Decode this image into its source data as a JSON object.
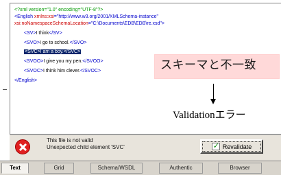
{
  "editor": {
    "lines": [
      {
        "parts": [
          {
            "cls": "pi",
            "text": "<?xml version=\"1.0\" encoding=\"UTF-8\"?>"
          }
        ]
      },
      {
        "parts": [
          {
            "cls": "tag",
            "text": "<English "
          },
          {
            "cls": "attr",
            "text": "xmlns:xsi"
          },
          {
            "cls": "tag",
            "text": "=\"http://www.w3.org/2001/XMLSchema-instance\""
          }
        ]
      },
      {
        "parts": [
          {
            "cls": "attr",
            "text": "xsi:noNamespaceSchemaLocation"
          },
          {
            "cls": "tag",
            "text": "=\"C:\\Documents\\EDB\\EDB\\re.xsd\">"
          }
        ]
      },
      {
        "parts": [
          {
            "cls": "tag",
            "text": "<SV>"
          },
          {
            "cls": "txt",
            "text": "I think"
          },
          {
            "cls": "tag",
            "text": "</SV>"
          }
        ]
      },
      {
        "parts": [
          {
            "cls": "tag",
            "text": "<SVO>"
          },
          {
            "cls": "txt",
            "text": "I go to school."
          },
          {
            "cls": "tag",
            "text": "</SVO>"
          }
        ]
      },
      {
        "parts": [
          {
            "cls": "tag",
            "text": "<SVC>"
          },
          {
            "cls": "txt",
            "text": "I am a boy."
          },
          {
            "cls": "tag",
            "text": "</SVC>"
          }
        ],
        "selected": true
      },
      {
        "parts": [
          {
            "cls": "tag",
            "text": "<SVOO>"
          },
          {
            "cls": "txt",
            "text": "I give you my pen."
          },
          {
            "cls": "tag",
            "text": "</SVOO>"
          }
        ]
      },
      {
        "parts": [
          {
            "cls": "tag",
            "text": "<SVOC>"
          },
          {
            "cls": "txt",
            "text": "I think him clever."
          },
          {
            "cls": "tag",
            "text": "</SVOC>"
          }
        ]
      },
      {
        "parts": [
          {
            "cls": "tag",
            "text": "</English>"
          }
        ]
      }
    ]
  },
  "annotation": {
    "mismatch_label": "スキーマと不一致",
    "validation_label": "Validationエラー"
  },
  "status": {
    "line1": "This file is not valid",
    "line2": "Unexpected child element 'SVC'",
    "revalidate_label": "Revalidate"
  },
  "tabs": [
    {
      "label": "Text",
      "active": true
    },
    {
      "label": "Grid",
      "active": false
    },
    {
      "label": "Schema/WSDL",
      "active": false
    },
    {
      "label": "Authentic",
      "active": false
    },
    {
      "label": "Browser",
      "active": false
    }
  ],
  "colors": {
    "selection": "#0a246a",
    "tag": "#0000cc",
    "attribute": "#cc0000",
    "processing_instruction": "#009900",
    "callout_background": "#ffd9d9",
    "error_icon": "#e02020"
  }
}
